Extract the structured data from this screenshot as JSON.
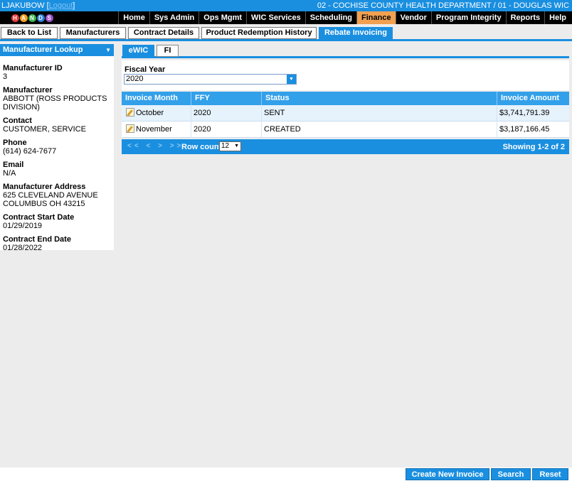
{
  "header": {
    "user": "LJAKUBOW",
    "logout_label": "Logout",
    "department": "02 - COCHISE COUNTY HEALTH DEPARTMENT / 01 - DOUGLAS WIC"
  },
  "logo_letters": [
    "H",
    "A",
    "N",
    "D",
    "S"
  ],
  "menu": [
    "Home",
    "Sys Admin",
    "Ops Mgmt",
    "WIC Services",
    "Scheduling",
    "Finance",
    "Vendor",
    "Program Integrity",
    "Reports",
    "Help"
  ],
  "active_menu": "Finance",
  "tabs": [
    "Back to List",
    "Manufacturers",
    "Contract Details",
    "Product Redemption History",
    "Rebate Invoicing"
  ],
  "active_tab": "Rebate Invoicing",
  "sidebar": {
    "lookup_label": "Manufacturer Lookup",
    "fields": [
      {
        "label": "Manufacturer ID",
        "lines": [
          "3"
        ]
      },
      {
        "label": "Manufacturer",
        "lines": [
          "ABBOTT (ROSS PRODUCTS",
          "DIVISION)"
        ]
      },
      {
        "label": "Contact",
        "lines": [
          "CUSTOMER, SERVICE"
        ]
      },
      {
        "label": "Phone",
        "lines": [
          "(614) 624-7677"
        ]
      },
      {
        "label": "Email",
        "lines": [
          "N/A"
        ]
      },
      {
        "label": "Manufacturer Address",
        "lines": [
          "625 CLEVELAND AVENUE",
          "COLUMBUS OH 43215"
        ]
      },
      {
        "label": "Contract Start Date",
        "lines": [
          "01/29/2019"
        ]
      },
      {
        "label": "Contract End Date",
        "lines": [
          "01/28/2022"
        ]
      }
    ]
  },
  "subtabs": [
    "eWIC",
    "FI"
  ],
  "fiscal_year": {
    "label": "Fiscal Year",
    "value": "2020"
  },
  "grid": {
    "columns": [
      "Invoice Month",
      "FFY",
      "Status",
      "Invoice Amount"
    ],
    "rows": [
      [
        "October",
        "2020",
        "SENT",
        "$3,741,791.39"
      ],
      [
        "November",
        "2020",
        "CREATED",
        "$3,187,166.45"
      ]
    ]
  },
  "pager": {
    "nav": "<< < > >>",
    "row_count_label": "Row count:",
    "row_count": "12",
    "showing": "Showing 1-2 of 2"
  },
  "buttons": [
    "Create New Invoice",
    "Search",
    "Reset"
  ],
  "colors": {
    "primary": "#1a8fe0",
    "active_menu": "#f0a050"
  }
}
